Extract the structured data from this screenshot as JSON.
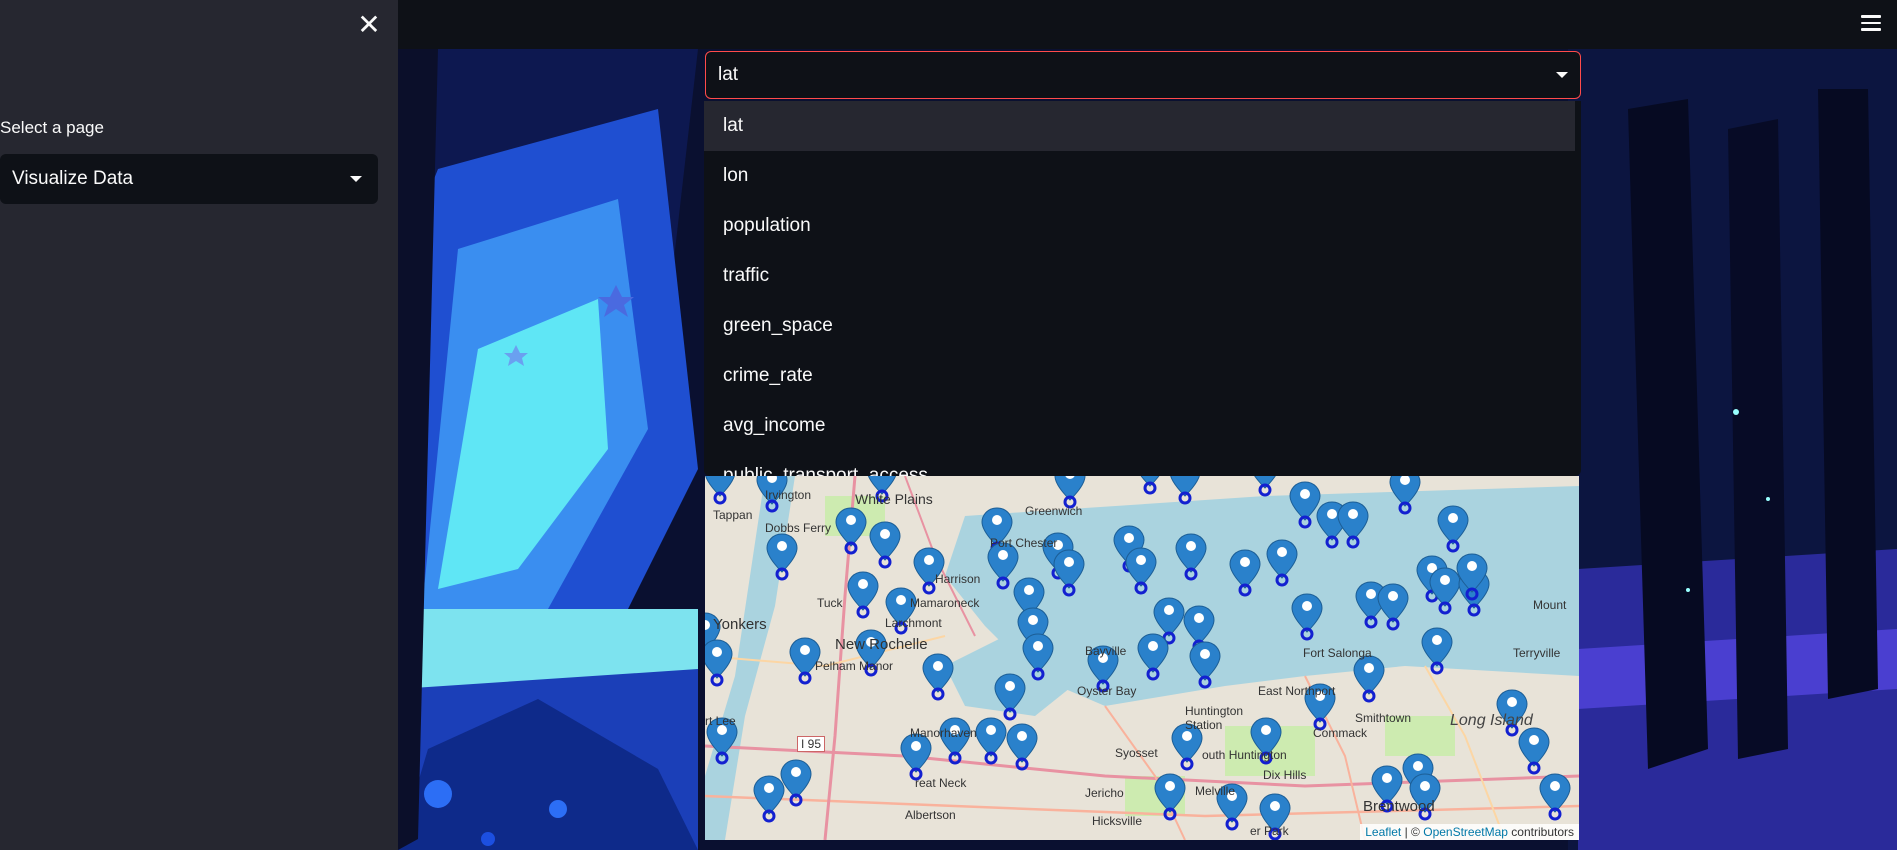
{
  "sidebar": {
    "select_label": "Select a page",
    "selected_page": "Visualize Data"
  },
  "column_select": {
    "value": "lat",
    "options": [
      "lat",
      "lon",
      "population",
      "traffic",
      "green_space",
      "crime_rate",
      "avg_income",
      "public_transport_access"
    ]
  },
  "map": {
    "labels": {
      "tappan": "Tappan",
      "irvington": "Irvington",
      "white_plains": "White Plains",
      "greenwich": "Greenwich",
      "dobbs_ferry": "Dobbs Ferry",
      "port_chester": "Port Chester",
      "harrison": "Harrison",
      "yonkers": "Yonkers",
      "tuckahoe": "Tuck",
      "new_rochelle": "New Rochelle",
      "larchmont": "Larchmont",
      "mamaroneck": "Mamaroneck",
      "pelham_manor": "Pelham Manor",
      "bayville": "Bayville",
      "oyster_bay": "Oyster Bay",
      "fort_salonga": "Fort Salonga",
      "east_northport": "East Northport",
      "huntington_station": "Huntington Station",
      "smithtown": "Smithtown",
      "long_island": "Long Island",
      "terryville": "Terryville",
      "mount_sinai": "Mount",
      "fort_lee": "rt Lee",
      "i95": "I 95",
      "manorhaven": "Manorhaven",
      "great_neck": "reat Neck",
      "syosset": "Syosset",
      "south_huntington": "outh Huntington",
      "dix_hills": "Dix Hills",
      "jericho": "Jericho",
      "melville": "Melville",
      "brentwood": "Brentwood",
      "albertson": "Albertson",
      "hicksville": "Hicksville",
      "deer_park": "er Park",
      "commack": "Commack"
    },
    "attribution": {
      "leaflet": "Leaflet",
      "separator": "| ©",
      "osm": "OpenStreetMap",
      "contributors": "contributors"
    }
  },
  "colors": {
    "accent": "#ff4b4b",
    "marker": "#2a81cb",
    "sidebar_bg": "#262730",
    "app_bg": "#0e1117"
  },
  "icons": {
    "close": "close-icon",
    "menu": "hamburger-menu-icon",
    "caret": "chevron-down-icon",
    "marker": "map-marker-icon"
  }
}
